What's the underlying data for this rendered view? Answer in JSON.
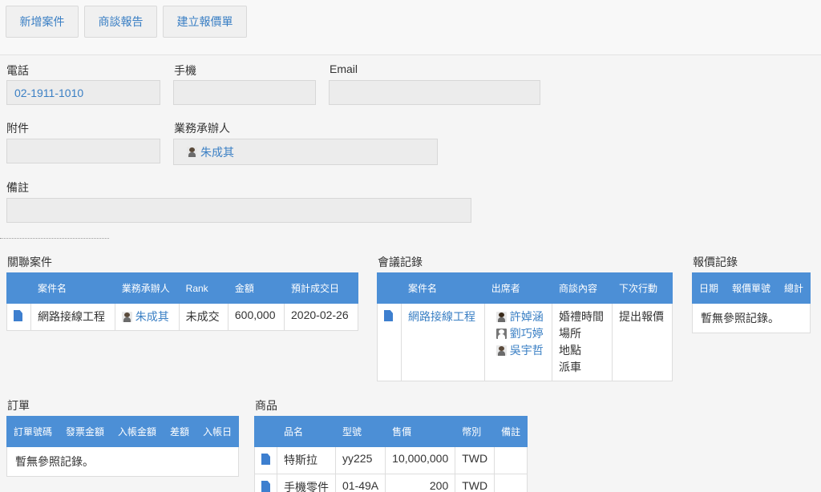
{
  "toolbar": {
    "buttons": [
      "新增案件",
      "商談報告",
      "建立報價單"
    ]
  },
  "fields": {
    "phone_label": "電話",
    "phone_value": "02-1911-1010",
    "mobile_label": "手機",
    "mobile_value": "",
    "email_label": "Email",
    "email_value": "",
    "attachment_label": "附件",
    "attachment_value": "",
    "owner_label": "業務承辦人",
    "owner_value": "朱成其",
    "note_label": "備註",
    "note_value": ""
  },
  "related_cases": {
    "title": "關聯案件",
    "headers": [
      "案件名",
      "業務承辦人",
      "Rank",
      "金額",
      "預計成交日"
    ],
    "rows": [
      {
        "name": "網路接線工程",
        "owner": "朱成其",
        "rank": "未成交",
        "amount": "600,000",
        "date": "2020-02-26"
      }
    ]
  },
  "meetings": {
    "title": "會議記錄",
    "headers": [
      "案件名",
      "出席者",
      "商談內容",
      "下次行動"
    ],
    "rows": [
      {
        "name": "網路接線工程",
        "attendees": [
          "許婥涵",
          "劉巧婷",
          "吳宇哲"
        ],
        "content": [
          "婚禮時間",
          "場所",
          "地點",
          "派車"
        ],
        "next": "提出報價"
      }
    ]
  },
  "quotes": {
    "title": "報價記錄",
    "headers": [
      "日期",
      "報價單號",
      "總計"
    ],
    "empty": "暫無參照記錄。"
  },
  "orders": {
    "title": "訂單",
    "headers": [
      "訂單號碼",
      "發票金額",
      "入帳金額",
      "差額",
      "入帳日"
    ],
    "empty": "暫無參照記錄。"
  },
  "products": {
    "title": "商品",
    "headers": [
      "品名",
      "型號",
      "售價",
      "幣別",
      "備註"
    ],
    "rows": [
      {
        "name": "特斯拉",
        "model": "yy225",
        "price": "10,000,000",
        "currency": "TWD",
        "note": ""
      },
      {
        "name": "手機零件",
        "model": "01-49A",
        "price": "200",
        "currency": "TWD",
        "note": ""
      }
    ]
  }
}
